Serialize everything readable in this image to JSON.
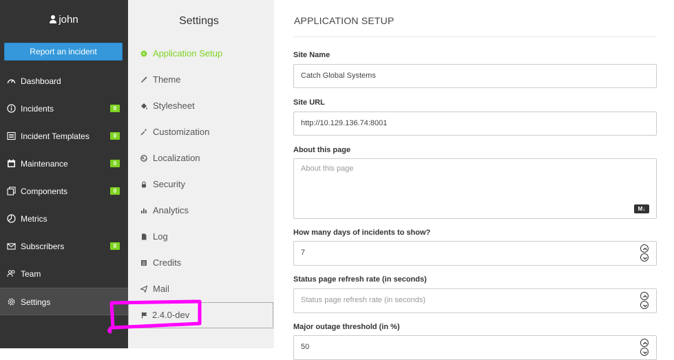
{
  "sidebar": {
    "username": "john",
    "report_button": "Report an incident",
    "items": [
      {
        "label": "Dashboard",
        "icon": "dashboard-icon"
      },
      {
        "label": "Incidents",
        "icon": "info-icon",
        "badge": "0"
      },
      {
        "label": "Incident Templates",
        "icon": "templates-icon",
        "badge": "0"
      },
      {
        "label": "Maintenance",
        "icon": "calendar-icon",
        "badge": "0"
      },
      {
        "label": "Components",
        "icon": "components-icon",
        "badge": "0"
      },
      {
        "label": "Metrics",
        "icon": "metrics-icon"
      },
      {
        "label": "Subscribers",
        "icon": "mail-icon",
        "badge": "0"
      },
      {
        "label": "Team",
        "icon": "team-icon"
      },
      {
        "label": "Settings",
        "icon": "settings-icon",
        "active": true
      }
    ]
  },
  "settings_nav": {
    "title": "Settings",
    "items": [
      {
        "label": "Application Setup",
        "icon": "gear-icon",
        "active": true
      },
      {
        "label": "Theme",
        "icon": "brush-icon"
      },
      {
        "label": "Stylesheet",
        "icon": "paint-bucket-icon"
      },
      {
        "label": "Customization",
        "icon": "magic-wand-icon"
      },
      {
        "label": "Localization",
        "icon": "globe-icon"
      },
      {
        "label": "Security",
        "icon": "lock-icon"
      },
      {
        "label": "Analytics",
        "icon": "analytics-icon"
      },
      {
        "label": "Log",
        "icon": "document-icon"
      },
      {
        "label": "Credits",
        "icon": "list-icon"
      },
      {
        "label": "Mail",
        "icon": "paper-plane-icon"
      }
    ],
    "version": "2.4.0-dev",
    "version_icon": "flag-icon"
  },
  "main": {
    "section_title": "APPLICATION SETUP",
    "site_name_label": "Site Name",
    "site_name_value": "Catch Global Systems",
    "site_url_label": "Site URL",
    "site_url_value": "http://10.129.136.74:8001",
    "about_label": "About this page",
    "about_placeholder": "About this page",
    "markdown_icon_text": "M↓",
    "days_label": "How many days of incidents to show?",
    "days_value": "7",
    "refresh_label": "Status page refresh rate (in seconds)",
    "refresh_placeholder": "Status page refresh rate (in seconds)",
    "outage_label": "Major outage threshold (in %)",
    "outage_value": "50"
  },
  "colors": {
    "sidebar_bg": "#333333",
    "accent_green": "#7ed321",
    "button_blue": "#3498db",
    "annotation_magenta": "#ff00ff"
  }
}
